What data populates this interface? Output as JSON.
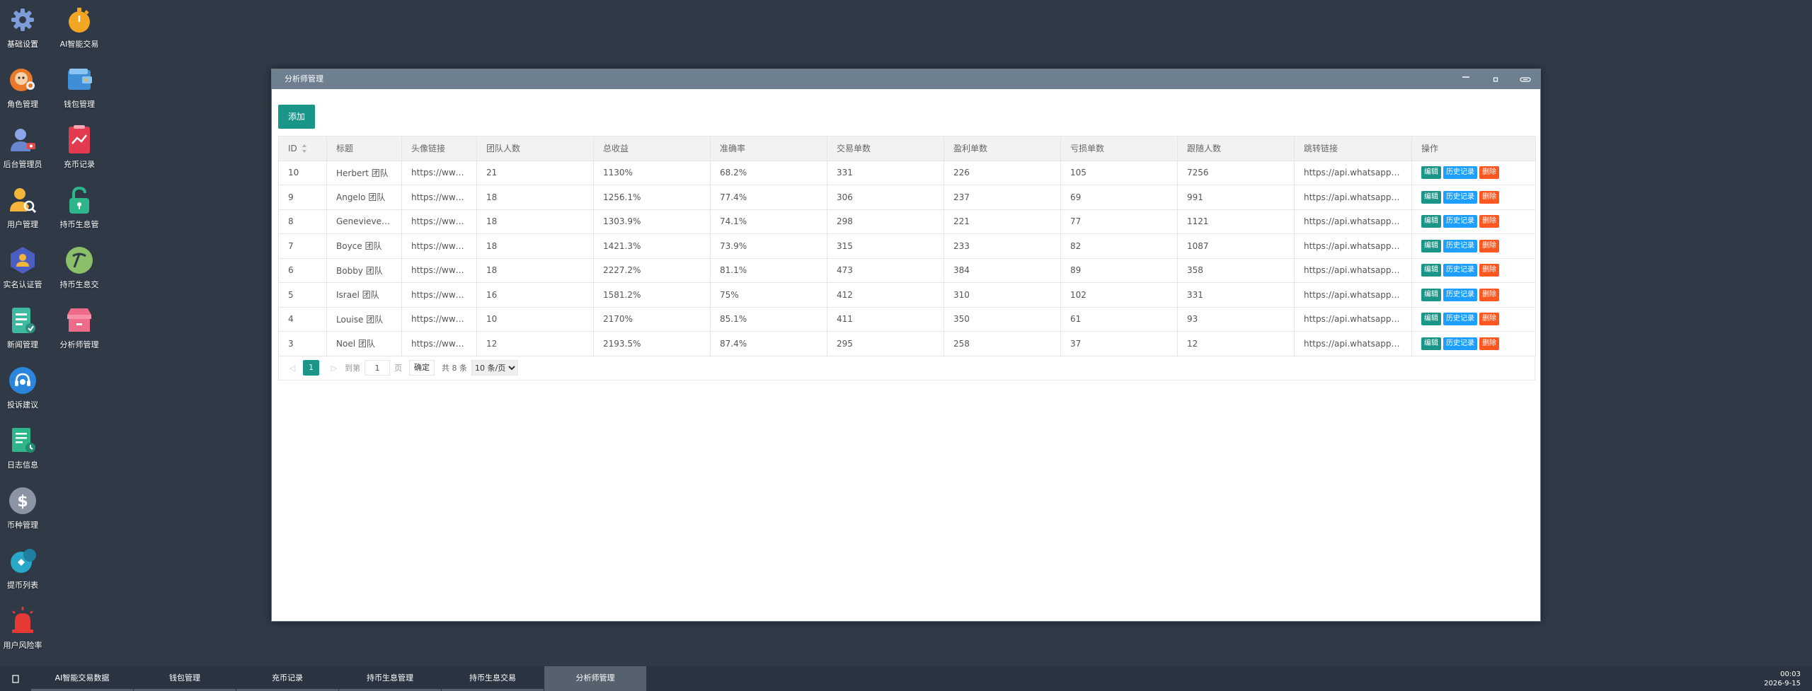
{
  "desktop": {
    "icons": [
      {
        "label": "基础设置",
        "icon": "gear-icon"
      },
      {
        "label": "AI智能交易",
        "icon": "stopwatch-icon"
      },
      {
        "label": "角色管理",
        "icon": "role-mask-icon"
      },
      {
        "label": "钱包管理",
        "icon": "wallet-icon"
      },
      {
        "label": "后台管理员",
        "icon": "admin-user-icon"
      },
      {
        "label": "充币记录",
        "icon": "deposit-chart-icon"
      },
      {
        "label": "用户管理",
        "icon": "user-search-icon"
      },
      {
        "label": "持币生息管",
        "icon": "unlock-icon"
      },
      {
        "label": "实名认证管",
        "icon": "id-verify-icon"
      },
      {
        "label": "持币生息交",
        "icon": "pickaxe-icon"
      },
      {
        "label": "新闻管理",
        "icon": "news-doc-icon"
      },
      {
        "label": "分析师管理",
        "icon": "store-box-icon"
      },
      {
        "label": "投诉建议",
        "icon": "complaint-headset-icon"
      },
      {
        "label": "日志信息",
        "icon": "log-clock-icon"
      },
      {
        "label": "币种管理",
        "icon": "dollar-coin-icon"
      },
      {
        "label": "提币列表",
        "icon": "withdraw-icon"
      },
      {
        "label": "用户风险率",
        "icon": "alarm-siren-icon"
      }
    ]
  },
  "window": {
    "title": "分析师管理",
    "add_label": "添加",
    "columns": [
      "ID",
      "标题",
      "头像链接",
      "团队人数",
      "总收益",
      "准确率",
      "交易单数",
      "盈利单数",
      "亏损单数",
      "跟随人数",
      "跳转链接",
      "操作"
    ],
    "rows": [
      [
        "10",
        "Herbert 团队",
        "https://www.…",
        "21",
        "1130%",
        "68.2%",
        "331",
        "226",
        "105",
        "7256",
        "https://api.whatsapp.c…"
      ],
      [
        "9",
        "Angelo 团队",
        "https://www.…",
        "18",
        "1256.1%",
        "77.4%",
        "306",
        "237",
        "69",
        "991",
        "https://api.whatsapp.c…"
      ],
      [
        "8",
        "Genevieve …",
        "https://www.…",
        "18",
        "1303.9%",
        "74.1%",
        "298",
        "221",
        "77",
        "1121",
        "https://api.whatsapp.c…"
      ],
      [
        "7",
        "Boyce 团队",
        "https://www.…",
        "18",
        "1421.3%",
        "73.9%",
        "315",
        "233",
        "82",
        "1087",
        "https://api.whatsapp.c…"
      ],
      [
        "6",
        "Bobby 团队",
        "https://www.…",
        "18",
        "2227.2%",
        "81.1%",
        "473",
        "384",
        "89",
        "358",
        "https://api.whatsapp.c…"
      ],
      [
        "5",
        "Israel 团队",
        "https://www.…",
        "16",
        "1581.2%",
        "75%",
        "412",
        "310",
        "102",
        "331",
        "https://api.whatsapp.c…"
      ],
      [
        "4",
        "Louise 团队",
        "https://www.…",
        "10",
        "2170%",
        "85.1%",
        "411",
        "350",
        "61",
        "93",
        "https://api.whatsapp.c…"
      ],
      [
        "3",
        "Noel 团队",
        "https://www.…",
        "12",
        "2193.5%",
        "87.4%",
        "295",
        "258",
        "37",
        "12",
        "https://api.whatsapp.c…"
      ]
    ],
    "actions": {
      "edit": "编辑",
      "history": "历史记录",
      "delete": "删除"
    },
    "pager": {
      "current": "1",
      "goto_label": "到第",
      "goto_value": "1",
      "page_unit": "页",
      "ok_label": "确定",
      "total": "共 8 条",
      "per_page": "10 条/页"
    }
  },
  "taskbar": {
    "items": [
      "AI智能交易数据",
      "钱包管理",
      "充币记录",
      "持币生息管理",
      "持币生息交易",
      "分析师管理"
    ],
    "active": "分析师管理",
    "time": "00:03",
    "date": "2026-9-15"
  },
  "colors": {
    "desktop_bg": "#2f3a46",
    "accent": "#1a9688",
    "history_btn": "#1e9fff",
    "delete_btn": "#ff5722"
  }
}
